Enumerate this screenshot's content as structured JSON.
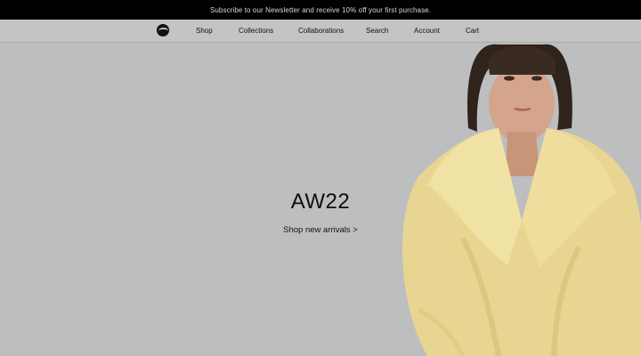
{
  "announcement": {
    "text": "Subscribe to our Newsletter and receive 10% off your first purchase."
  },
  "nav": {
    "items": [
      {
        "label": "Shop"
      },
      {
        "label": "Collections"
      },
      {
        "label": "Collaborations"
      },
      {
        "label": "Search"
      },
      {
        "label": "Account"
      },
      {
        "label": "Cart"
      }
    ]
  },
  "hero": {
    "title": "AW22",
    "cta": "Shop new arrivals >"
  },
  "colors": {
    "announcement_bg": "#000000",
    "nav_bg": "#c4c4c4",
    "hero_bg": "#bcbebf",
    "coat": "#e8d591"
  }
}
